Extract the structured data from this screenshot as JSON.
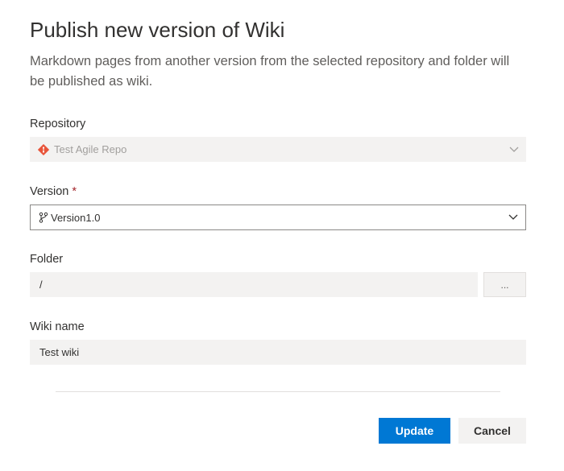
{
  "dialog": {
    "title": "Publish new version of Wiki",
    "description": "Markdown pages from another version from the selected repository and folder will be published as wiki."
  },
  "repository": {
    "label": "Repository",
    "value": "Test Agile Repo",
    "icon": "git-repo-icon",
    "icon_color": "#e8543a"
  },
  "version": {
    "label": "Version",
    "required_marker": "*",
    "value": "Version1.0",
    "icon": "branch-icon"
  },
  "folder": {
    "label": "Folder",
    "value": "/",
    "browse_label": "..."
  },
  "wiki_name": {
    "label": "Wiki name",
    "value": "Test wiki"
  },
  "actions": {
    "primary_label": "Update",
    "secondary_label": "Cancel",
    "primary_color": "#0078d4"
  }
}
